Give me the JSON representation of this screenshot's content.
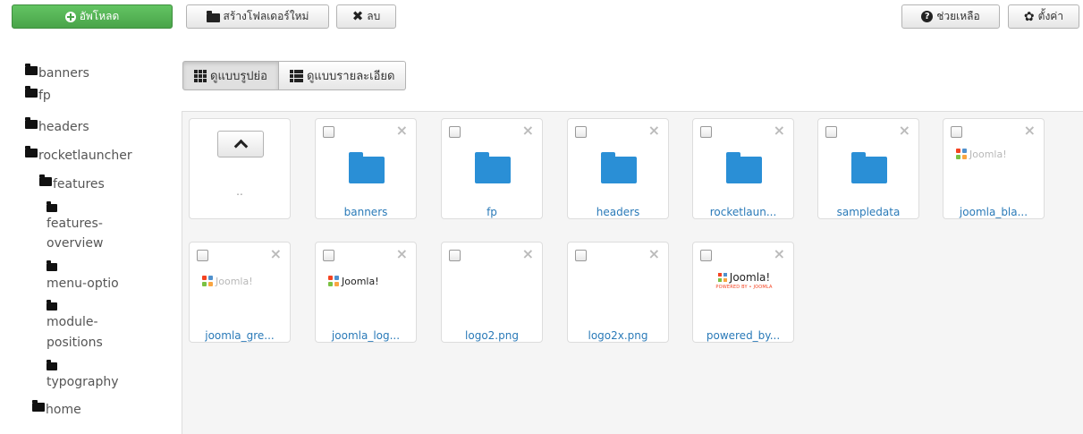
{
  "toolbar": {
    "upload_label": "อัพโหลด",
    "new_folder_label": "สร้างโฟลเดอร์ใหม่",
    "delete_label": "ลบ",
    "help_label": "ช่วยเหลือ",
    "settings_label": "ตั้งค่า"
  },
  "tree": {
    "banners": "banners",
    "fp": "fp",
    "headers": "headers",
    "rocketlauncher": "rocketlauncher",
    "features": "features",
    "features_overview_1": "features-",
    "features_overview_2": "overview",
    "menu_options": "menu-optio",
    "module_positions_1": "module-",
    "module_positions_2": "positions",
    "typography": "typography",
    "home": "home"
  },
  "view": {
    "thumbs_label": "ดูแบบรูปย่อ",
    "details_label": "ดูแบบรายละเอียด"
  },
  "files": {
    "up_label": "..",
    "folders": [
      "banners",
      "fp",
      "headers",
      "rocketlaun...",
      "sampledata"
    ],
    "images": [
      "joomla_bla...",
      "joomla_gre...",
      "joomla_log...",
      "logo2.png",
      "logo2x.png",
      "powered_by..."
    ],
    "logo_text": "Joomla!",
    "powered_sub": "POWERED BY • JOOMLA"
  },
  "colors": {
    "upload_green": "#4aa44a",
    "folder_blue": "#2a8fd6",
    "link_blue": "#2a7ab8"
  }
}
